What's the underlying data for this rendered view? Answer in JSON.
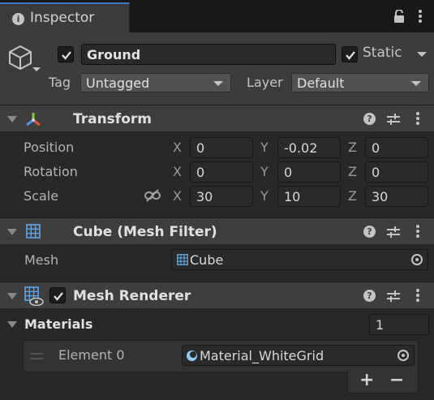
{
  "window": {
    "tab_label": "Inspector"
  },
  "gameobject": {
    "active": true,
    "name": "Ground",
    "static_checked": true,
    "static_label": "Static",
    "tag_label": "Tag",
    "tag_value": "Untagged",
    "layer_label": "Layer",
    "layer_value": "Default"
  },
  "transform": {
    "title": "Transform",
    "rows": [
      {
        "label": "Position",
        "x": "0",
        "y": "-0.02",
        "z": "0"
      },
      {
        "label": "Rotation",
        "x": "0",
        "y": "0",
        "z": "0"
      },
      {
        "label": "Scale",
        "x": "30",
        "y": "10",
        "z": "30"
      }
    ],
    "axis_x": "X",
    "axis_y": "Y",
    "axis_z": "Z"
  },
  "mesh_filter": {
    "title": "Cube (Mesh Filter)",
    "mesh_label": "Mesh",
    "mesh_value": "Cube"
  },
  "mesh_renderer": {
    "title": "Mesh Renderer",
    "enabled": true,
    "materials_label": "Materials",
    "materials_count": "1",
    "element_label": "Element 0",
    "element_value": "Material_WhiteGrid",
    "add_label": "+",
    "remove_label": "−"
  },
  "icons": {
    "tab": "info-icon",
    "lock": "lock-icon",
    "menu": "kebab-menu-icon",
    "gameobject": "cube-icon",
    "transform": "transform-gizmo-icon",
    "mesh_filter": "mesh-grid-icon",
    "mesh_renderer": "mesh-renderer-icon",
    "help": "help-icon",
    "presets": "sliders-icon",
    "scale_link": "unlinked-chain-icon",
    "object_picker": "object-picker-icon",
    "material": "material-sphere-icon"
  },
  "colors": {
    "tab_accent": "#3a79bb",
    "panel_bg": "#282828",
    "header_bg": "#3e3e3e",
    "field_bg": "#2a2a2a"
  }
}
